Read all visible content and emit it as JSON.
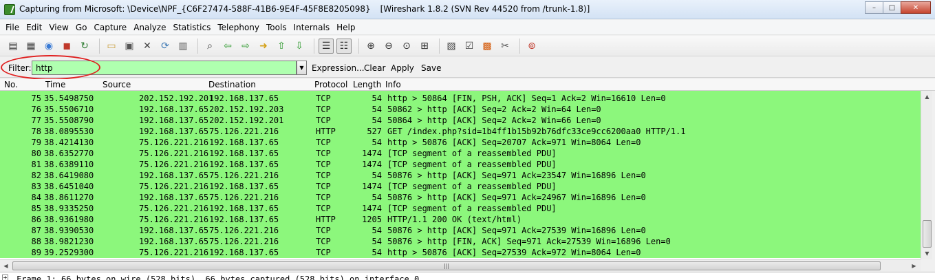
{
  "window": {
    "title": "Capturing from Microsoft: \\Device\\NPF_{C6F27474-588F-41B6-9E4F-45F8E8205098}",
    "version": "[Wireshark 1.8.2  (SVN Rev 44520 from /trunk-1.8)]",
    "minimize": "–",
    "maximize": "□",
    "close": "✕"
  },
  "menu": [
    "File",
    "Edit",
    "View",
    "Go",
    "Capture",
    "Analyze",
    "Statistics",
    "Telephony",
    "Tools",
    "Internals",
    "Help"
  ],
  "toolbar_icons": [
    "interfaces-icon",
    "capture-options-icon",
    "start-capture-icon",
    "stop-capture-icon",
    "restart-capture-icon",
    "sep",
    "open-file-icon",
    "save-file-icon",
    "close-file-icon",
    "reload-icon",
    "print-icon",
    "sep",
    "find-icon",
    "back-icon",
    "forward-icon",
    "goto-packet-icon",
    "first-packet-icon",
    "last-packet-icon",
    "sep",
    "colorize-icon",
    "autoscroll-icon",
    "sep",
    "zoom-in-icon",
    "zoom-out-icon",
    "normal-size-icon",
    "resize-columns-icon",
    "sep",
    "capture-filters-icon",
    "display-filters-icon",
    "coloring-rules-icon",
    "preferences-icon",
    "sep",
    "help-icon"
  ],
  "filter": {
    "label": "Filter:",
    "value": "http",
    "expression": "Expression...",
    "clear": "Clear",
    "apply": "Apply",
    "save": "Save",
    "dropdown": "▼"
  },
  "columns": {
    "no": "No.",
    "time": "Time",
    "source": "Source",
    "destination": "Destination",
    "protocol": "Protocol",
    "length": "Length",
    "info": "Info"
  },
  "packets": [
    {
      "no": "75",
      "time": "35.5498750",
      "src": "202.152.192.201",
      "dst": "192.168.137.65",
      "proto": "TCP",
      "len": "54",
      "info": "http > 50864 [FIN, PSH, ACK] Seq=1 Ack=2 Win=16610 Len=0"
    },
    {
      "no": "76",
      "time": "35.5506710",
      "src": "192.168.137.65",
      "dst": "202.152.192.203",
      "proto": "TCP",
      "len": "54",
      "info": "50862 > http [ACK] Seq=2 Ack=2 Win=64 Len=0"
    },
    {
      "no": "77",
      "time": "35.5508790",
      "src": "192.168.137.65",
      "dst": "202.152.192.201",
      "proto": "TCP",
      "len": "54",
      "info": "50864 > http [ACK] Seq=2 Ack=2 Win=66 Len=0"
    },
    {
      "no": "78",
      "time": "38.0895530",
      "src": "192.168.137.65",
      "dst": "75.126.221.216",
      "proto": "HTTP",
      "len": "527",
      "info": "GET /index.php?sid=1b4ff1b15b92b76dfc33ce9cc6200aa0 HTTP/1.1"
    },
    {
      "no": "79",
      "time": "38.4214130",
      "src": "75.126.221.216",
      "dst": "192.168.137.65",
      "proto": "TCP",
      "len": "54",
      "info": "http > 50876 [ACK] Seq=20707 Ack=971 Win=8064 Len=0"
    },
    {
      "no": "80",
      "time": "38.6352770",
      "src": "75.126.221.216",
      "dst": "192.168.137.65",
      "proto": "TCP",
      "len": "1474",
      "info": "[TCP segment of a reassembled PDU]"
    },
    {
      "no": "81",
      "time": "38.6389110",
      "src": "75.126.221.216",
      "dst": "192.168.137.65",
      "proto": "TCP",
      "len": "1474",
      "info": "[TCP segment of a reassembled PDU]"
    },
    {
      "no": "82",
      "time": "38.6419080",
      "src": "192.168.137.65",
      "dst": "75.126.221.216",
      "proto": "TCP",
      "len": "54",
      "info": "50876 > http [ACK] Seq=971 Ack=23547 Win=16896 Len=0"
    },
    {
      "no": "83",
      "time": "38.6451040",
      "src": "75.126.221.216",
      "dst": "192.168.137.65",
      "proto": "TCP",
      "len": "1474",
      "info": "[TCP segment of a reassembled PDU]"
    },
    {
      "no": "84",
      "time": "38.8611270",
      "src": "192.168.137.65",
      "dst": "75.126.221.216",
      "proto": "TCP",
      "len": "54",
      "info": "50876 > http [ACK] Seq=971 Ack=24967 Win=16896 Len=0"
    },
    {
      "no": "85",
      "time": "38.9335250",
      "src": "75.126.221.216",
      "dst": "192.168.137.65",
      "proto": "TCP",
      "len": "1474",
      "info": "[TCP segment of a reassembled PDU]"
    },
    {
      "no": "86",
      "time": "38.9361980",
      "src": "75.126.221.216",
      "dst": "192.168.137.65",
      "proto": "HTTP",
      "len": "1205",
      "info": "HTTP/1.1 200 OK  (text/html)"
    },
    {
      "no": "87",
      "time": "38.9390530",
      "src": "192.168.137.65",
      "dst": "75.126.221.216",
      "proto": "TCP",
      "len": "54",
      "info": "50876 > http [ACK] Seq=971 Ack=27539 Win=16896 Len=0"
    },
    {
      "no": "88",
      "time": "38.9821230",
      "src": "192.168.137.65",
      "dst": "75.126.221.216",
      "proto": "TCP",
      "len": "54",
      "info": "50876 > http [FIN, ACK] Seq=971 Ack=27539 Win=16896 Len=0"
    },
    {
      "no": "89",
      "time": "39.2529300",
      "src": "75.126.221.216",
      "dst": "192.168.137.65",
      "proto": "TCP",
      "len": "54",
      "info": "http > 50876 [ACK] Seq=27539 Ack=972 Win=8064 Len=0"
    }
  ],
  "detail": {
    "expander": "+",
    "line": "Frame 1: 66 bytes on wire (528 bits), 66 bytes captured (528 bits) on interface 0"
  },
  "colors": {
    "row_green": "#8cf77c",
    "filter_ok": "#afffaf",
    "annotation_red": "#e02020"
  }
}
